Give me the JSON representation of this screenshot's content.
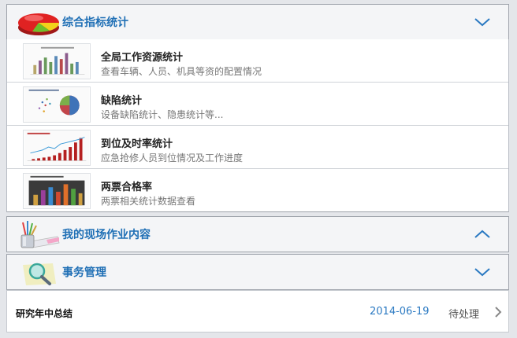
{
  "sections": [
    {
      "title": "综合指标统计",
      "icon": "pie-chart-icon",
      "expanded": true
    },
    {
      "title": "我的现场作业内容",
      "icon": "pencil-cup-icon",
      "expanded": false
    },
    {
      "title": "事务管理",
      "icon": "magnifier-icon",
      "expanded": true
    }
  ],
  "stats_items": [
    {
      "title": "全局工作资源统计",
      "desc": "查看车辆、人员、机具等资的配置情况",
      "thumb": "bar-chart-thumbnail"
    },
    {
      "title": "缺陷统计",
      "desc": "设备缺陷统计、隐患统计等...",
      "thumb": "pie-chart-thumbnail"
    },
    {
      "title": "到位及时率统计",
      "desc": "应急抢修人员到位情况及工作进度",
      "thumb": "line-bar-chart-thumbnail"
    },
    {
      "title": "两票合格率",
      "desc": "两票相关统计数据查看",
      "thumb": "dark-bar-chart-thumbnail"
    }
  ],
  "task": {
    "title": "研究年中总结",
    "date": "2014-06-19",
    "status": "待处理"
  },
  "colors": {
    "accent": "#1f6fb5",
    "date": "#2a79c2",
    "header_bg": "#f4f5f7"
  }
}
